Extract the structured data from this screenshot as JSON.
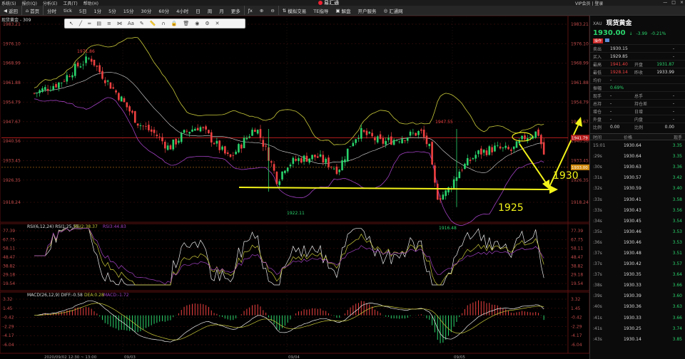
{
  "menu": {
    "items": [
      "系统(S)",
      "报价(Q)",
      "分析(E)",
      "工具(T)",
      "帮助(H)"
    ],
    "app_name": "易汇通",
    "user": "VIP会员 | 登录",
    "window_controls": [
      "—",
      "□",
      "×"
    ]
  },
  "toolbar": {
    "items": [
      "返回",
      "首页",
      "分时",
      "tick",
      "5日",
      "1分",
      "5分",
      "15分",
      "30分",
      "60分",
      "4小时",
      "日",
      "周",
      "月",
      "更多",
      "模拟交易",
      "TE指导",
      "解盘",
      "开户服务",
      "汇通网"
    ]
  },
  "chart": {
    "title": "现货黄金 - 309",
    "price_axis": [
      "1983.21",
      "1976.10",
      "1968.99",
      "1961.88",
      "1954.79",
      "1947.67",
      "1940.56",
      "1933.45",
      "1926.35",
      "1918.24"
    ],
    "rsi_axis": [
      "77.39",
      "67.75",
      "58.11",
      "48.47",
      "38.82",
      "29.18",
      "19.54"
    ],
    "macd_axis": [
      "3.32",
      "1.45",
      "-0.42",
      "-2.29",
      "-4.17",
      "-6.04"
    ],
    "rsi_label": "RSI(6,12,24) RSI1:25.55",
    "rsi2_label": "RSI2:38.37",
    "rsi3_label": "RSI3:44.83",
    "macd_label": "MACD(26,12,9) DIFF:-0.58",
    "dea_label": "DEA:0.28",
    "macd_val_label": "MACD:-1.72",
    "annotations": {
      "high1": "1971.86",
      "high2": "1947.55",
      "low1": "1922.11",
      "low2": "1916.48",
      "level_1925": "1925",
      "level_1930": "1930",
      "tag_1941": "1941.79",
      "tag_1933": "1933.00"
    },
    "date_axis": [
      "2020/09/02 12:30 ~ 13:00",
      "09/03",
      "09/04",
      "09/05"
    ],
    "colors": {
      "up": "#2ad46c",
      "down": "#ef4040",
      "ma": "#ddd",
      "boll_upper": "#c9c93a",
      "boll_lower": "#a040c0",
      "annotation": "#f3f31a"
    }
  },
  "drawtools": {
    "icons": [
      "cursor-icon",
      "line-icon",
      "hline-icon",
      "channel-icon",
      "fib-icon",
      "pattern-icon",
      "text-icon",
      "pen-icon",
      "ruler-icon",
      "magnet-icon",
      "lock-icon",
      "trash-icon",
      "eye-icon",
      "settings-icon",
      "close-icon"
    ],
    "text_label": "Aa"
  },
  "panel": {
    "sym": "XAU",
    "name": "现货黄金",
    "price": "1930.00",
    "arrow": "↓",
    "change": "-3.99",
    "change_pct": "-0.21%",
    "tag": "操作",
    "rows": [
      {
        "l": "卖出",
        "v": "1930.15",
        "l2": "",
        "v2": "-"
      },
      {
        "l": "买入",
        "v": "1929.85",
        "l2": "",
        "v2": "-"
      },
      {
        "l": "最高",
        "v": "1941.40",
        "l2": "开盘",
        "v2": "1931.87"
      },
      {
        "l": "最低",
        "v": "1928.14",
        "l2": "昨收",
        "v2": "1933.99"
      },
      {
        "l": "均价",
        "v": "-",
        "l2": "",
        "v2": ""
      },
      {
        "l": "振幅",
        "v": "0.69%",
        "l2": "",
        "v2": ""
      },
      {
        "l": "现手",
        "v": "-",
        "l2": "总手",
        "v2": "-"
      },
      {
        "l": "总持",
        "v": "-",
        "l2": "持仓差",
        "v2": "-"
      },
      {
        "l": "增仓",
        "v": "-",
        "l2": "日增",
        "v2": "-"
      },
      {
        "l": "外盘",
        "v": "-",
        "l2": "内盘",
        "v2": "-"
      },
      {
        "l": "比例",
        "v": "0.00",
        "l2": "比例",
        "v2": "0.00"
      }
    ],
    "tick_headers": [
      "时间",
      "价格",
      "现手"
    ],
    "ticks": [
      {
        "t": "15:01",
        "p": "1930.64",
        "s": "3.35"
      },
      {
        "t": ":29s",
        "p": "1930.64",
        "s": "3.35"
      },
      {
        "t": ":30s",
        "p": "1930.63",
        "s": "3.36"
      },
      {
        "t": ":31s",
        "p": "1930.57",
        "s": "3.42"
      },
      {
        "t": ":32s",
        "p": "1930.59",
        "s": "3.40"
      },
      {
        "t": ":33s",
        "p": "1930.41",
        "s": "3.58"
      },
      {
        "t": ":33s",
        "p": "1930.43",
        "s": "3.56"
      },
      {
        "t": ":34s",
        "p": "1930.45",
        "s": "3.54"
      },
      {
        "t": ":35s",
        "p": "1930.46",
        "s": "3.53"
      },
      {
        "t": ":36s",
        "p": "1930.46",
        "s": "3.53"
      },
      {
        "t": ":37s",
        "p": "1930.48",
        "s": "3.51"
      },
      {
        "t": ":37s",
        "p": "1930.42",
        "s": "3.57"
      },
      {
        "t": ":37s",
        "p": "1930.35",
        "s": "3.64"
      },
      {
        "t": ":38s",
        "p": "1930.33",
        "s": "3.66"
      },
      {
        "t": ":39s",
        "p": "1930.39",
        "s": "3.60"
      },
      {
        "t": ":40s",
        "p": "1930.36",
        "s": "3.63"
      },
      {
        "t": ":41s",
        "p": "1930.33",
        "s": "3.66"
      },
      {
        "t": ":41s",
        "p": "1930.25",
        "s": "3.74"
      },
      {
        "t": ":43s",
        "p": "1930.14",
        "s": "3.85"
      }
    ]
  }
}
